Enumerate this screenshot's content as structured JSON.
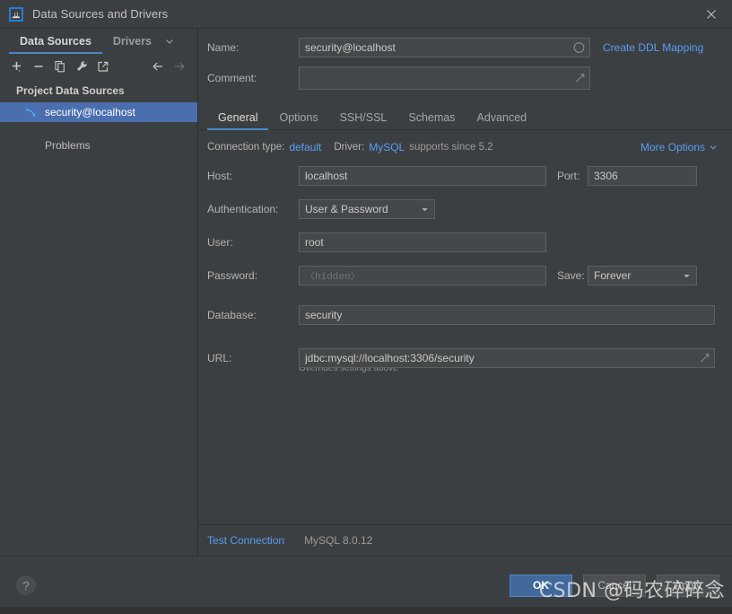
{
  "window": {
    "title": "Data Sources and Drivers",
    "app_icon": "intellij-idea-icon",
    "close_label": "✕"
  },
  "sidebar": {
    "tabs": [
      {
        "label": "Data Sources",
        "active": true
      },
      {
        "label": "Drivers",
        "active": false
      }
    ],
    "tab_chevron": "chevron-down-icon",
    "toolbar": [
      {
        "name": "add-data-source-button",
        "glyph": "+"
      },
      {
        "name": "remove-data-source-button",
        "glyph": "−"
      },
      {
        "name": "copy-data-source-button",
        "glyph": "copy-icon"
      },
      {
        "name": "properties-button",
        "glyph": "wrench-icon"
      },
      {
        "name": "open-external-button",
        "glyph": "external-link-icon"
      },
      {
        "name": "back-button",
        "glyph": "←"
      },
      {
        "name": "forward-button",
        "glyph": "→"
      }
    ],
    "tree_header": "Project Data Sources",
    "items": [
      {
        "label": "security@localhost",
        "icon": "mysql-dolphin-icon",
        "selected": true
      }
    ],
    "problems_label": "Problems"
  },
  "details": {
    "name_label": "Name:",
    "name_value": "security@localhost",
    "name_tail_icon": "circle-icon",
    "create_ddl_link": "Create DDL Mapping",
    "comment_label": "Comment:",
    "comment_value": "",
    "comment_tail_icon": "expand-icon",
    "tabs": [
      {
        "label": "General",
        "active": true
      },
      {
        "label": "Options",
        "active": false
      },
      {
        "label": "SSH/SSL",
        "active": false
      },
      {
        "label": "Schemas",
        "active": false
      },
      {
        "label": "Advanced",
        "active": false
      }
    ],
    "connection_type_label": "Connection type:",
    "connection_type_value": "default",
    "driver_label": "Driver:",
    "driver_value": "MySQL",
    "driver_supports": "supports since 5.2",
    "more_options_label": "More Options",
    "more_options_icon": "chevron-down-icon",
    "host_label": "Host:",
    "host_value": "localhost",
    "port_label": "Port:",
    "port_value": "3306",
    "auth_label": "Authentication:",
    "auth_value": "User & Password",
    "user_label": "User:",
    "user_value": "root",
    "password_label": "Password:",
    "password_placeholder": "〈hidden〉",
    "save_label": "Save:",
    "save_value": "Forever",
    "database_label": "Database:",
    "database_value": "security",
    "url_label": "URL:",
    "url_value": "jdbc:mysql://localhost:3306/security",
    "url_tail_icon": "expand-icon",
    "url_hint": "Overrides settings above",
    "test_connection_link": "Test Connection",
    "driver_version": "MySQL 8.0.12"
  },
  "footer": {
    "help_label": "?",
    "ok_label": "OK",
    "cancel_label": "Cancel",
    "apply_label": "Apply"
  },
  "watermark": "CSDN @码农碎碎念",
  "colors": {
    "accent_blue": "#4a88c7",
    "link_blue": "#589df6",
    "selection_blue": "#4b6eaf",
    "panel_bg": "#3c3f41",
    "field_bg": "#45484a",
    "primary_button": "#41699c"
  }
}
